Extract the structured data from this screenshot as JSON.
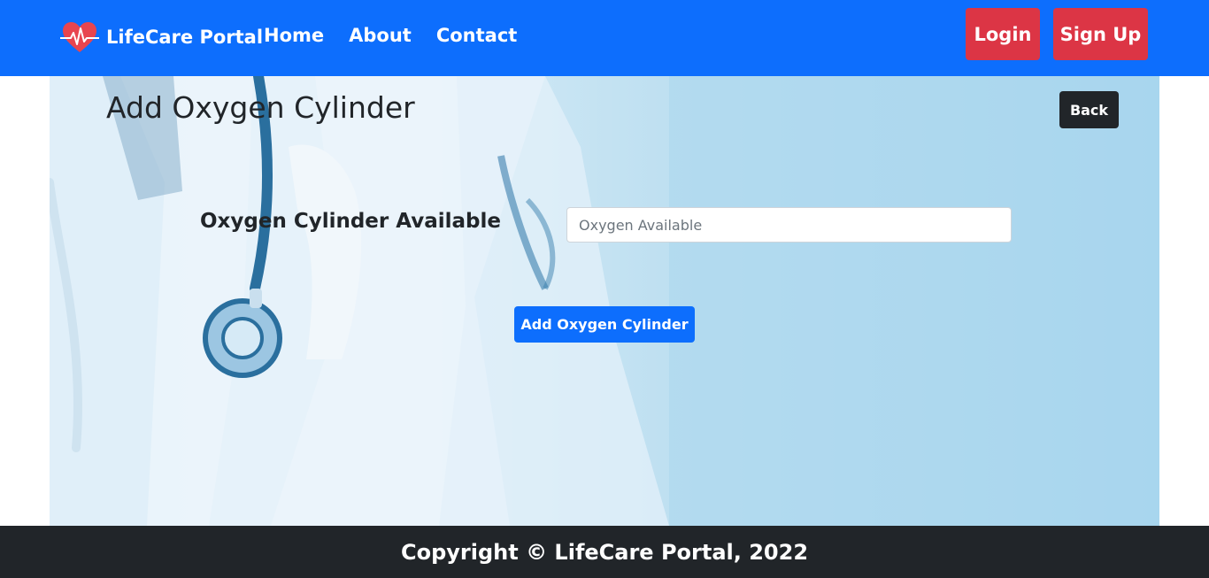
{
  "navbar": {
    "brand_icon": "heartbeat-icon",
    "brand_name": "LifeCare Portal",
    "links": [
      "Home",
      "About",
      "Contact"
    ],
    "login_label": "Login",
    "signup_label": "Sign Up",
    "colors": {
      "background": "#0d6efd",
      "auth_buttons": "#dc3545"
    }
  },
  "main": {
    "title": "Add Oxygen Cylinder",
    "back_label": "Back",
    "form": {
      "label": "Oxygen Cylinder Available",
      "input_value": "",
      "input_placeholder": "Oxygen Available",
      "submit_label": "Add Oxygen Cylinder"
    }
  },
  "footer": {
    "text": "Copyright © LifeCare Portal, 2022",
    "background": "#212529"
  }
}
